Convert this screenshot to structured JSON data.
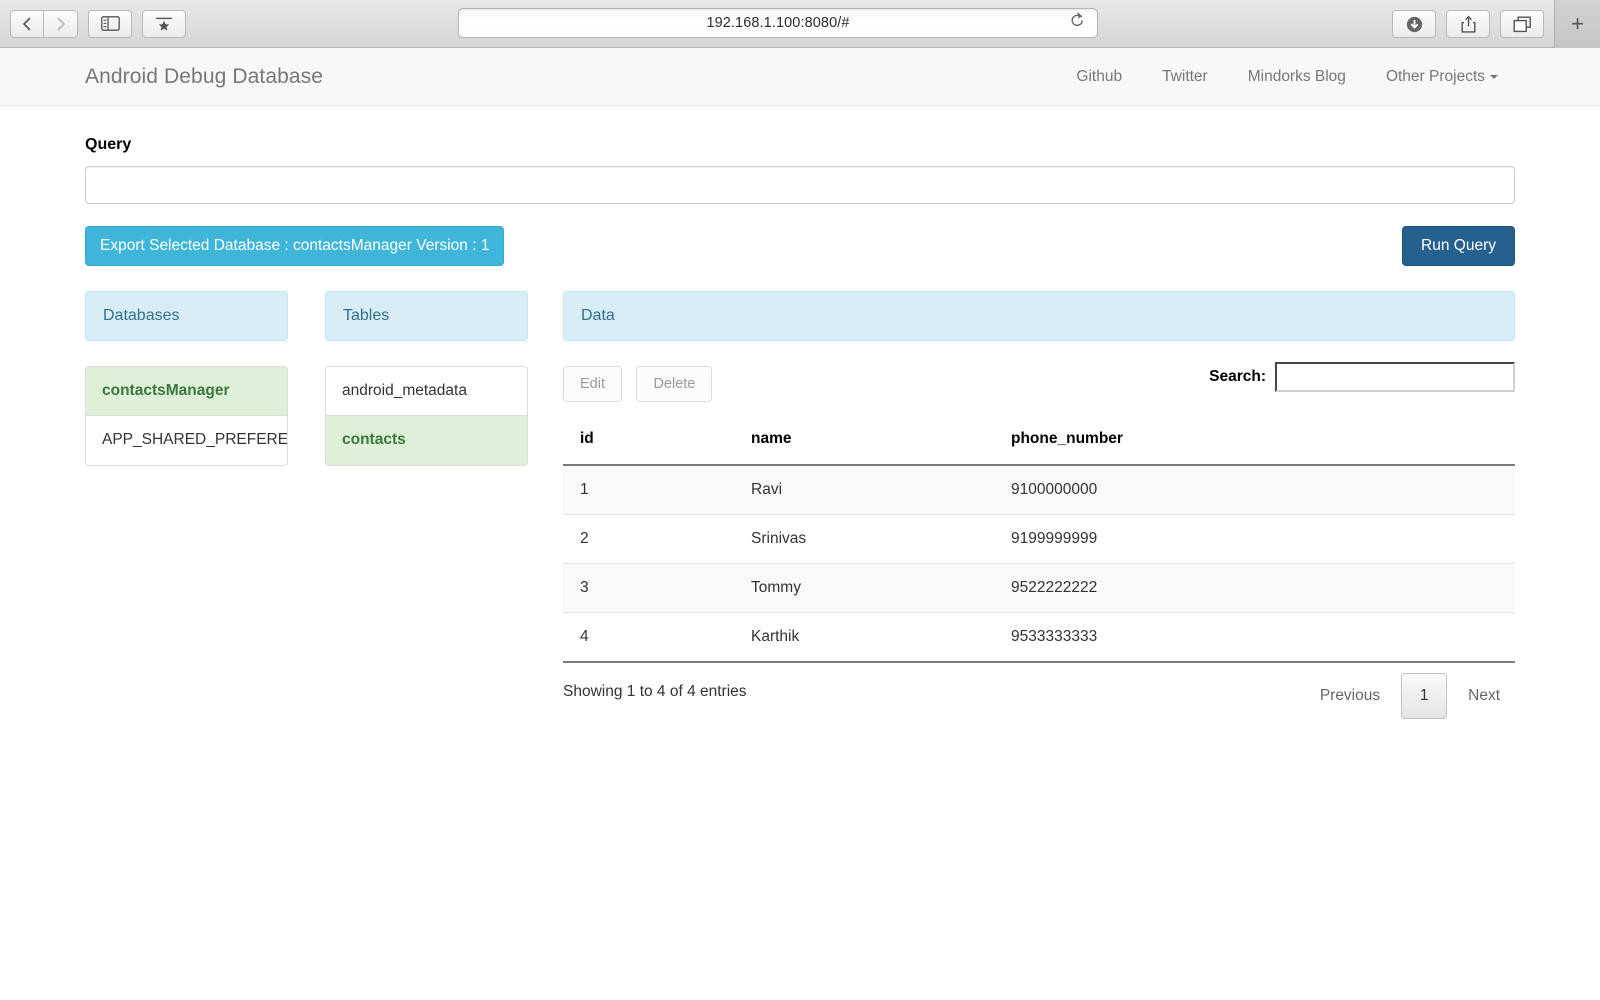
{
  "browser": {
    "back_icon": "chevron-left-icon",
    "forward_icon": "chevron-right-icon",
    "sidebar_icon": "sidebar-panel-icon",
    "bookmark_icon": "bookmark-star-icon",
    "url": "192.168.1.100:8080/#",
    "reload_icon": "reload-icon",
    "download_icon": "download-icon",
    "share_icon": "share-icon",
    "tabs_icon": "tab-overview-icon",
    "newtab_label": "+"
  },
  "navbar": {
    "brand": "Android Debug Database",
    "links": [
      {
        "label": "Github"
      },
      {
        "label": "Twitter"
      },
      {
        "label": "Mindorks Blog"
      },
      {
        "label": "Other Projects",
        "caret": true
      }
    ]
  },
  "query": {
    "label": "Query",
    "value": "",
    "placeholder": ""
  },
  "actions": {
    "export_label": "Export Selected Database : contactsManager Version : 1",
    "run_label": "Run Query"
  },
  "panels": {
    "databases": {
      "title": "Databases",
      "items": [
        {
          "label": "contactsManager",
          "active": true
        },
        {
          "label": "APP_SHARED_PREFERENCES",
          "active": false
        }
      ]
    },
    "tables": {
      "title": "Tables",
      "items": [
        {
          "label": "android_metadata",
          "active": false
        },
        {
          "label": "contacts",
          "active": true
        }
      ]
    },
    "data": {
      "title": "Data",
      "edit_label": "Edit",
      "delete_label": "Delete",
      "search_label": "Search:",
      "search_value": "",
      "columns": [
        "id",
        "name",
        "phone_number"
      ],
      "rows": [
        [
          "1",
          "Ravi",
          "9100000000"
        ],
        [
          "2",
          "Srinivas",
          "9199999999"
        ],
        [
          "3",
          "Tommy",
          "9522222222"
        ],
        [
          "4",
          "Karthik",
          "9533333333"
        ]
      ],
      "entries_info": "Showing 1 to 4 of 4 entries",
      "pagination": {
        "previous": "Previous",
        "current": "1",
        "next": "Next"
      }
    }
  },
  "colors": {
    "panel_header_bg": "#d9edf7",
    "panel_header_text": "#31708f",
    "active_item_bg": "#dff0d8",
    "active_item_text": "#3c763d",
    "export_btn": "#3fb6d9",
    "run_btn": "#26608f"
  }
}
